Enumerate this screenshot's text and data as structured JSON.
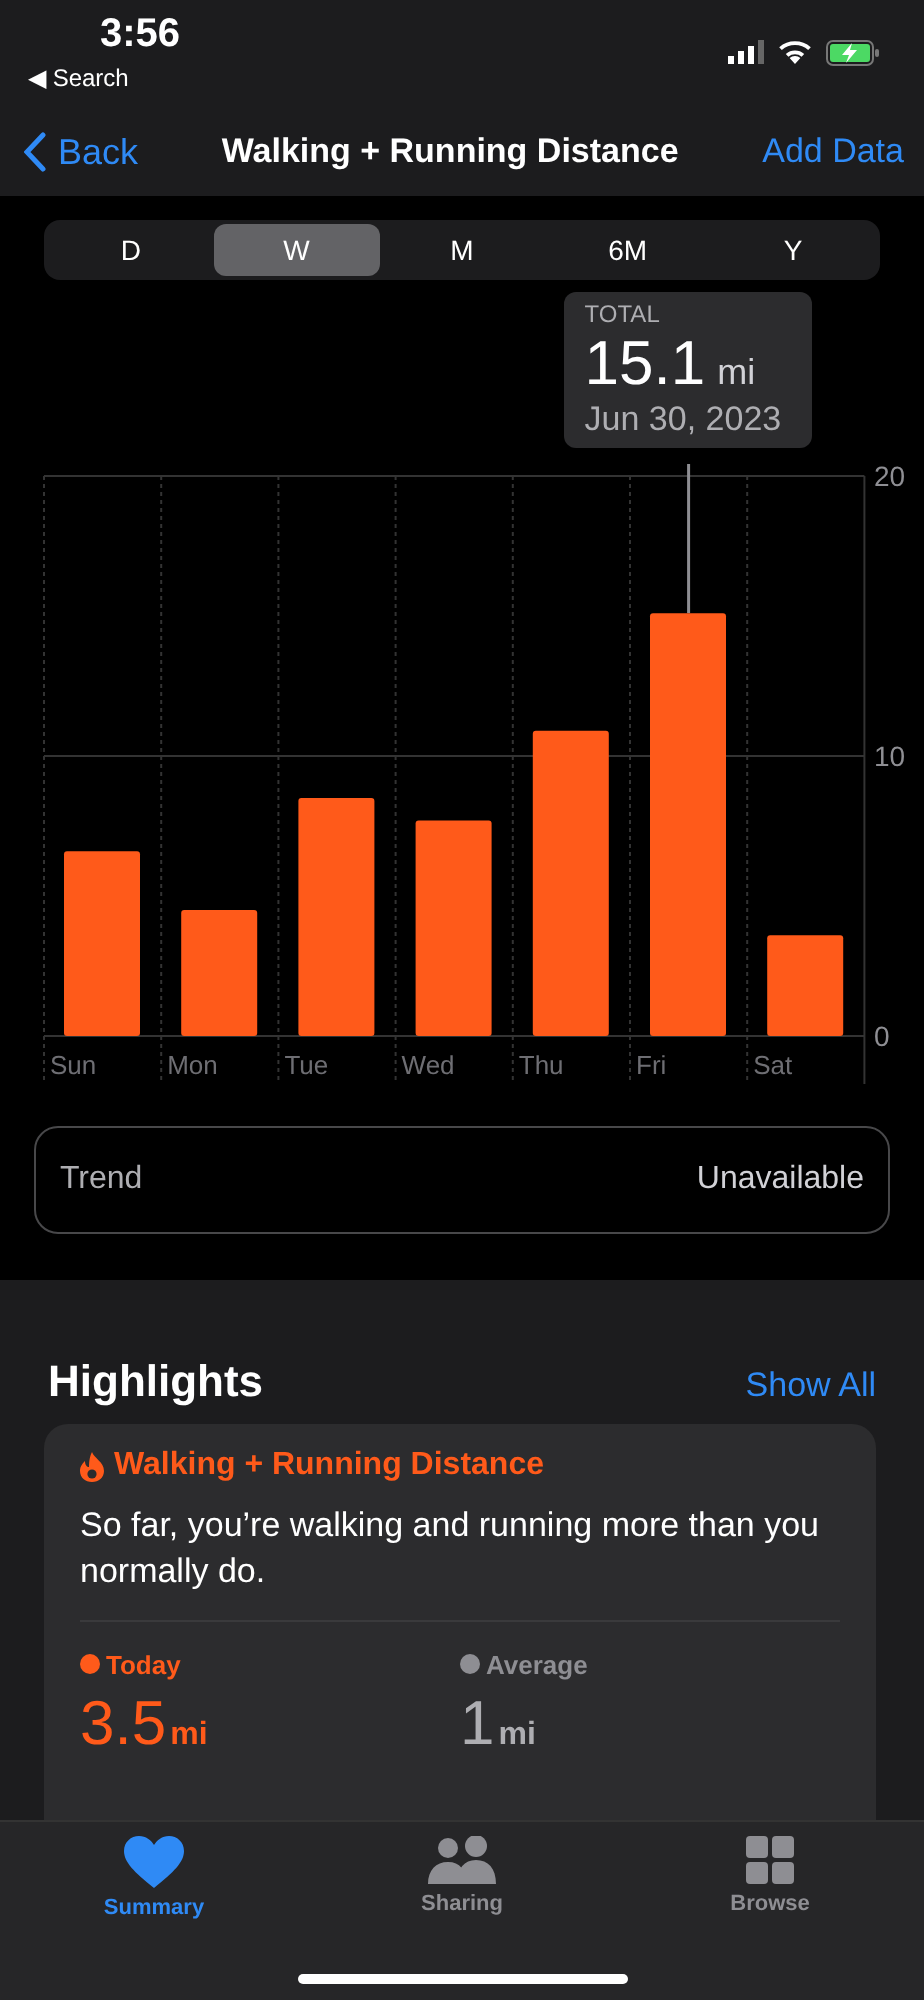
{
  "status_bar": {
    "time": "3:56",
    "back_app": "◀ Search"
  },
  "nav": {
    "back": "Back",
    "title": "Walking + Running Distance",
    "action": "Add Data"
  },
  "segments": [
    {
      "label": "D",
      "selected": false
    },
    {
      "label": "W",
      "selected": true
    },
    {
      "label": "M",
      "selected": false
    },
    {
      "label": "6M",
      "selected": false
    },
    {
      "label": "Y",
      "selected": false
    }
  ],
  "tooltip": {
    "label": "TOTAL",
    "value": "15.1",
    "unit": "mi",
    "date": "Jun 30, 2023"
  },
  "chart_data": {
    "type": "bar",
    "categories": [
      "Sun",
      "Mon",
      "Tue",
      "Wed",
      "Thu",
      "Fri",
      "Sat"
    ],
    "values": [
      6.6,
      4.5,
      8.5,
      7.7,
      10.9,
      15.1,
      3.6
    ],
    "ylim": [
      0,
      20
    ],
    "yticks": [
      0,
      10,
      20
    ]
  },
  "trend": {
    "label": "Trend",
    "value": "Unavailable"
  },
  "highlights": {
    "title": "Highlights",
    "action": "Show All",
    "card": {
      "title": "Walking + Running Distance",
      "text": "So far, you’re walking and running more than you normally do.",
      "stats": [
        {
          "label": "Today",
          "value": "3.5",
          "unit": "mi",
          "color": "#ff5a1a"
        },
        {
          "label": "Average",
          "value": "1",
          "unit": "mi",
          "color": "#8e8e93"
        }
      ]
    }
  },
  "tabs": [
    {
      "label": "Summary",
      "selected": true
    },
    {
      "label": "Sharing",
      "selected": false
    },
    {
      "label": "Browse",
      "selected": false
    }
  ]
}
